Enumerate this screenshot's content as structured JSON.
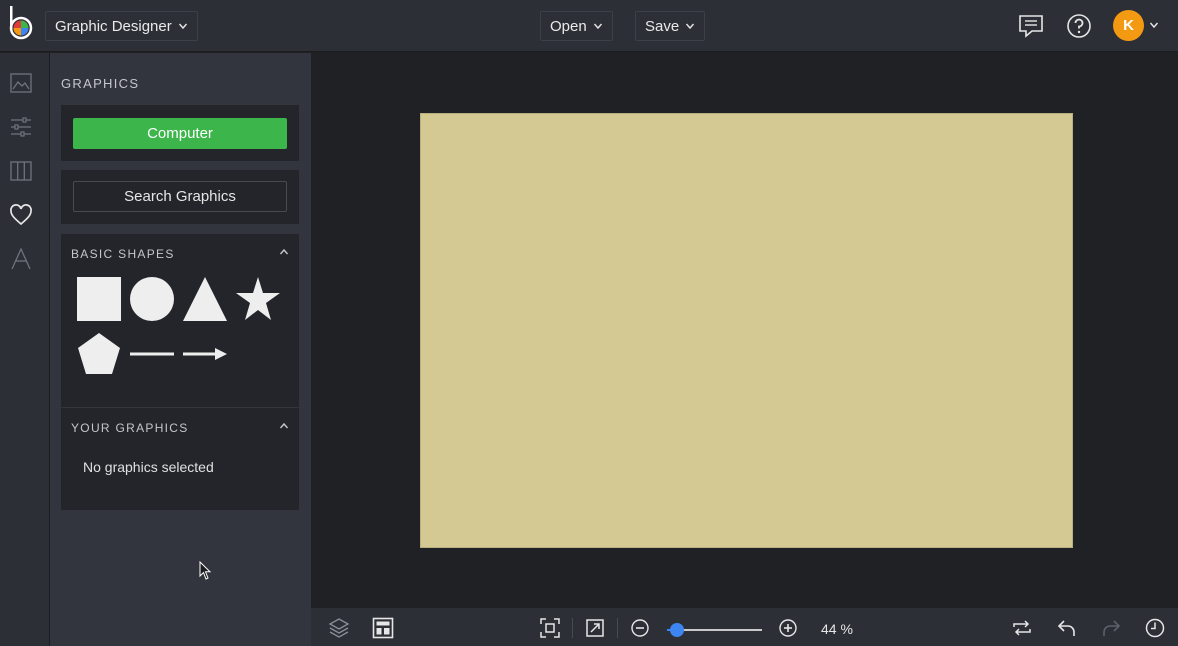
{
  "header": {
    "app_name": "Graphic Designer",
    "open_label": "Open",
    "save_label": "Save",
    "avatar_initial": "K",
    "avatar_color": "#f39a12"
  },
  "rail": {
    "icons": [
      "image-icon",
      "sliders-icon",
      "columns-icon",
      "heart-icon",
      "text-icon"
    ]
  },
  "panel": {
    "title": "GRAPHICS",
    "computer_label": "Computer",
    "search_label": "Search Graphics",
    "basic_shapes": {
      "label": "BASIC SHAPES",
      "shapes": [
        "square",
        "circle",
        "triangle",
        "star",
        "pentagon",
        "line",
        "arrow"
      ]
    },
    "your_graphics": {
      "label": "YOUR GRAPHICS",
      "empty_text": "No graphics selected"
    }
  },
  "canvas": {
    "background": "#d4c993"
  },
  "footer": {
    "zoom_text": "44 %",
    "zoom_level": 0.44,
    "accent": "#3d86f1"
  },
  "colors": {
    "primary_button": "#3cb54b",
    "topbar": "#2c2f36"
  }
}
